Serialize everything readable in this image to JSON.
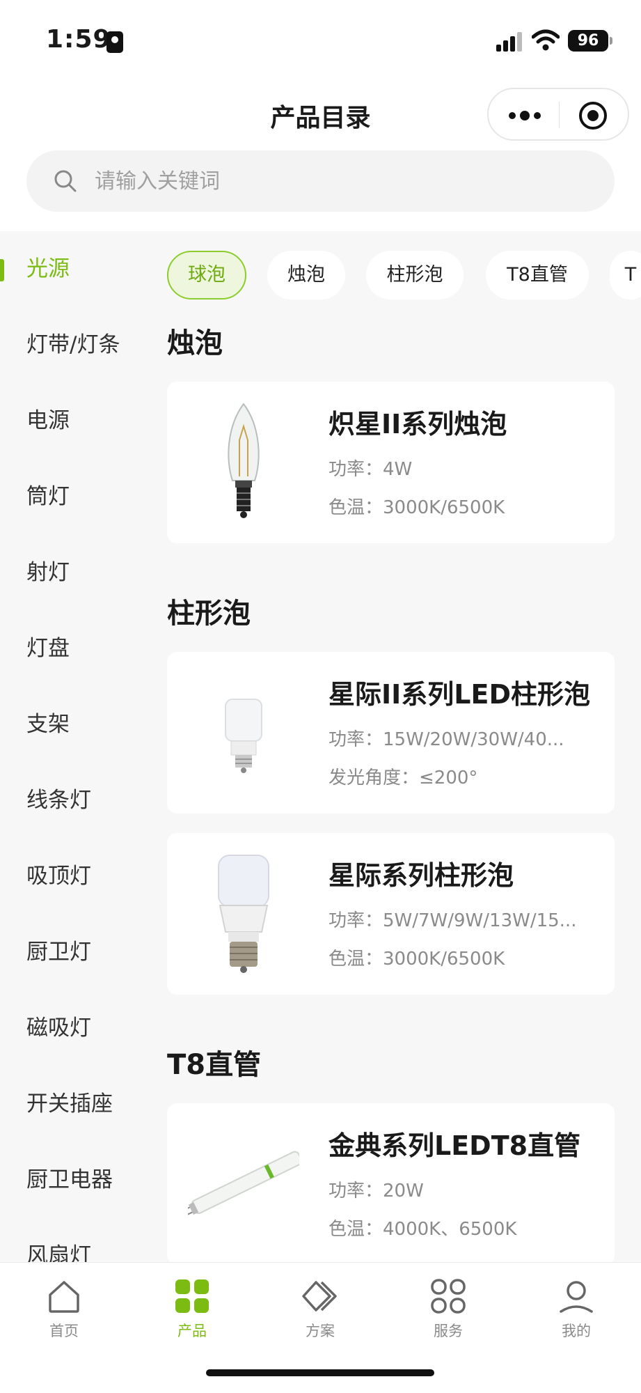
{
  "status_bar": {
    "time": "1:59",
    "battery": "96"
  },
  "header": {
    "title": "产品目录"
  },
  "search": {
    "placeholder": "请输入关键词"
  },
  "sidebar": {
    "items": [
      {
        "label": "光源",
        "active": true
      },
      {
        "label": "灯带/灯条"
      },
      {
        "label": "电源"
      },
      {
        "label": "筒灯"
      },
      {
        "label": "射灯"
      },
      {
        "label": "灯盘"
      },
      {
        "label": "支架"
      },
      {
        "label": "线条灯"
      },
      {
        "label": "吸顶灯"
      },
      {
        "label": "厨卫灯"
      },
      {
        "label": "磁吸灯"
      },
      {
        "label": "开关插座"
      },
      {
        "label": "厨卫电器"
      },
      {
        "label": "风扇灯"
      }
    ]
  },
  "chips": [
    {
      "label": "球泡",
      "active": true
    },
    {
      "label": "烛泡"
    },
    {
      "label": "柱形泡"
    },
    {
      "label": "T8直管"
    },
    {
      "label": "T"
    }
  ],
  "sections": [
    {
      "title": "烛泡",
      "products": [
        {
          "name": "炽星II系列烛泡",
          "spec1": "功率：4W",
          "spec2": "色温：3000K/6500K",
          "image": "candle-bulb-icon"
        }
      ]
    },
    {
      "title": "柱形泡",
      "products": [
        {
          "name": "星际II系列LED柱形泡",
          "spec1": "功率：15W/20W/30W/40...",
          "spec2": "发光角度：≤200°",
          "image": "small-column-bulb-icon"
        },
        {
          "name": "星际系列柱形泡",
          "spec1": "功率：5W/7W/9W/13W/15...",
          "spec2": "色温：3000K/6500K",
          "image": "column-bulb-icon"
        }
      ]
    },
    {
      "title": "T8直管",
      "products": [
        {
          "name": "金典系列LEDT8直管",
          "spec1": "功率：20W",
          "spec2": "色温：4000K、6500K",
          "image": "t8-tube-icon"
        }
      ]
    }
  ],
  "tabbar": {
    "tabs": [
      {
        "label": "首页",
        "icon": "home-icon"
      },
      {
        "label": "产品",
        "icon": "product-grid-icon",
        "active": true
      },
      {
        "label": "方案",
        "icon": "solution-icon"
      },
      {
        "label": "服务",
        "icon": "service-icon"
      },
      {
        "label": "我的",
        "icon": "profile-icon"
      }
    ]
  },
  "colors": {
    "accent": "#7cbb12",
    "chip_active_bg": "#eef7de",
    "panel_bg": "#f7f7f7"
  }
}
